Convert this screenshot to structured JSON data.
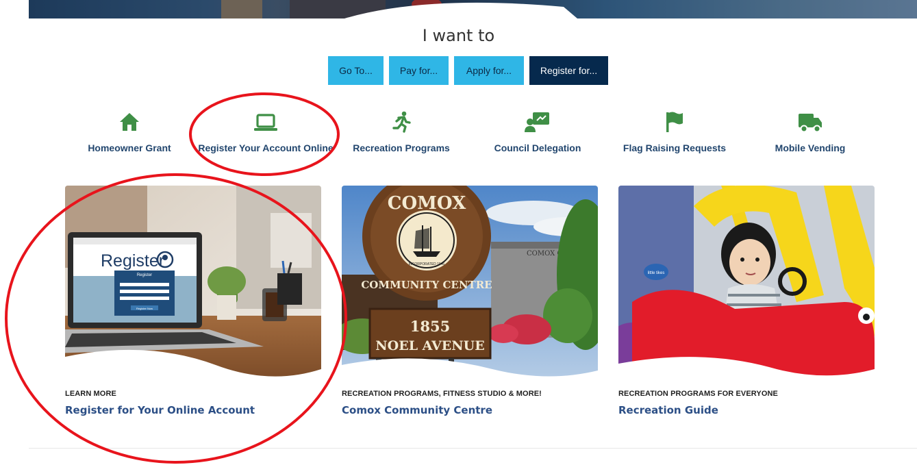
{
  "section_title": "I want to",
  "tabs": [
    {
      "label": "Go To...",
      "active": false
    },
    {
      "label": "Pay for...",
      "active": false
    },
    {
      "label": "Apply for...",
      "active": false
    },
    {
      "label": "Register for...",
      "active": true
    }
  ],
  "quick_links": [
    {
      "label": "Homeowner Grant",
      "icon": "home-icon"
    },
    {
      "label": "Register Your Account Online",
      "icon": "laptop-icon"
    },
    {
      "label": "Recreation Programs",
      "icon": "running-icon"
    },
    {
      "label": "Council Delegation",
      "icon": "presentation-icon"
    },
    {
      "label": "Flag Raising Requests",
      "icon": "flag-icon"
    },
    {
      "label": "Mobile Vending",
      "icon": "truck-icon"
    }
  ],
  "cards": [
    {
      "eyebrow": "LEARN MORE",
      "title": "Register for Your Online Account",
      "image_text": {
        "heading": "Register",
        "form_title": "Register",
        "button": "Register Now"
      }
    },
    {
      "eyebrow": "RECREATION PROGRAMS, FITNESS STUDIO & MORE!",
      "title": "Comox Community Centre",
      "image_text": {
        "sign_top": "COMOX",
        "sign_bottom": "COMMUNITY CENTRE",
        "seal": "INCORPORATED 1946",
        "address_number": "1855",
        "address_street": "NOEL AVENUE",
        "building_sign": "COMOX C"
      }
    },
    {
      "eyebrow": "RECREATION PROGRAMS FOR EVERYONE",
      "title": "Recreation Guide",
      "image_text": {
        "toy_brand": "little tikes"
      }
    }
  ],
  "colors": {
    "tab_blue": "#2fb6e6",
    "tab_active": "#06294d",
    "icon_green": "#3f8f46",
    "link_blue": "#22466e",
    "card_title_blue": "#2c4f86",
    "annotation_red": "#e8141c"
  }
}
